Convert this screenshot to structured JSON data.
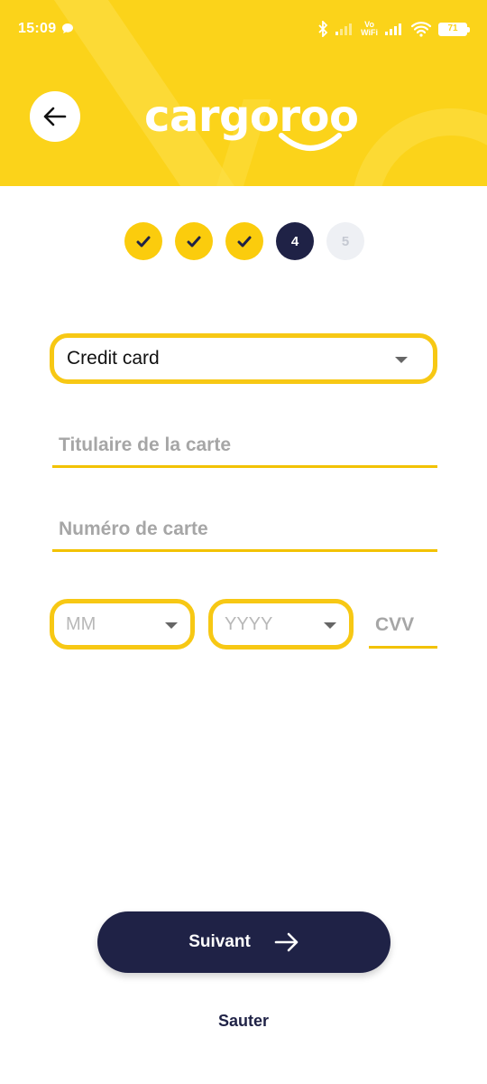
{
  "status_bar": {
    "time": "15:09",
    "vowifi_top": "Vo",
    "vowifi_bottom": "WiFi",
    "battery": "71"
  },
  "header": {
    "logo_text": "cargoroo",
    "brand_color": "#fbd31a"
  },
  "stepper": {
    "steps": [
      {
        "label": "",
        "state": "done"
      },
      {
        "label": "",
        "state": "done"
      },
      {
        "label": "",
        "state": "done"
      },
      {
        "label": "4",
        "state": "current"
      },
      {
        "label": "5",
        "state": "future"
      }
    ]
  },
  "form": {
    "payment_method": "Credit card",
    "card_holder_placeholder": "Titulaire de la carte",
    "card_number_placeholder": "Numéro de carte",
    "month_placeholder": "MM",
    "year_placeholder": "YYYY",
    "cvv_placeholder": "CVV"
  },
  "actions": {
    "next_label": "Suivant",
    "skip_label": "Sauter"
  },
  "colors": {
    "accent_yellow": "#fbcc0d",
    "navy": "#1f2246"
  }
}
